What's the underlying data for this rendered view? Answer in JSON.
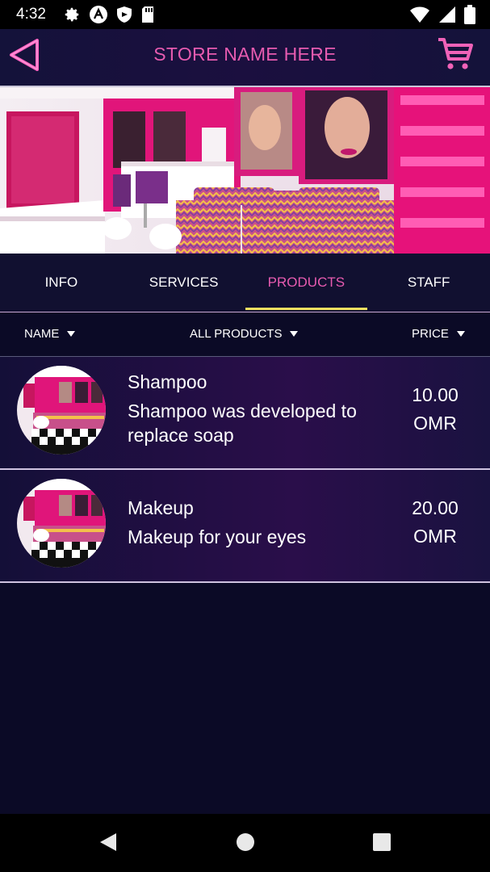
{
  "status_bar": {
    "time": "4:32",
    "left_icons": [
      "gear-icon",
      "a-icon",
      "shield-icon",
      "sd-card-icon"
    ],
    "right_icons": [
      "wifi-icon",
      "signal-icon",
      "battery-icon"
    ]
  },
  "header": {
    "title": "STORE NAME HERE",
    "accent_color": "#e75bb0"
  },
  "tabs": [
    {
      "label": "INFO",
      "active": false
    },
    {
      "label": "SERVICES",
      "active": false
    },
    {
      "label": "PRODUCTS",
      "active": true
    },
    {
      "label": "STAFF",
      "active": false
    }
  ],
  "sort": {
    "name_label": "NAME",
    "filter_label": "ALL PRODUCTS",
    "price_label": "PRICE"
  },
  "products": [
    {
      "name": "Shampoo",
      "description": "Shampoo was developed to replace soap",
      "price": "10.00",
      "currency": "OMR"
    },
    {
      "name": "Makeup",
      "description": "Makeup for your eyes",
      "price": "20.00",
      "currency": "OMR"
    }
  ],
  "colors": {
    "background": "#0b0a26",
    "accent_pink": "#e75bb0",
    "tab_indicator": "#f0e060"
  }
}
